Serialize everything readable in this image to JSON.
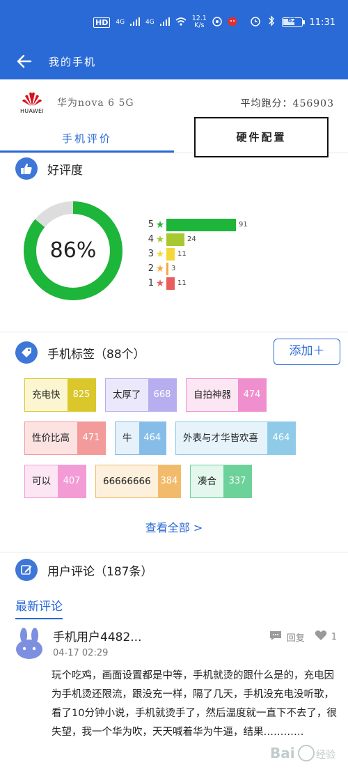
{
  "status": {
    "hd": "HD",
    "signal1": "4G",
    "signal2": "4G",
    "speed": "12.1",
    "speed_unit": "K/s",
    "battery": "62",
    "time": "11:31"
  },
  "app_bar": {
    "title": "我的手机"
  },
  "phone": {
    "brand": "HUAWEI",
    "model": "华为nova 6 5G",
    "score": "平均跑分：456903"
  },
  "tabs": [
    {
      "label": "手机评价"
    },
    {
      "label": "硬件配置"
    }
  ],
  "rating": {
    "title": "好评度",
    "percent_label": "86%",
    "percent": 86,
    "rows": [
      {
        "stars": "5",
        "count": "91",
        "value": 91,
        "color": "#1db53a"
      },
      {
        "stars": "4",
        "count": "24",
        "value": 24,
        "color": "#a8c832"
      },
      {
        "stars": "3",
        "count": "11",
        "value": 11,
        "color": "#f4d83a"
      },
      {
        "stars": "2",
        "count": "3",
        "value": 3,
        "color": "#f5a83a"
      },
      {
        "stars": "1",
        "count": "11",
        "value": 11,
        "color": "#ea5d5d"
      }
    ],
    "ring_color": "#1db53a",
    "ring_track_color": "#dddddd"
  },
  "tags": {
    "title": "手机标签（88个）",
    "add_label": "添加＋",
    "items": [
      {
        "label": "充电快",
        "count": "825",
        "bg": "#fbf6cf",
        "border": "#d9c72b",
        "count_bg": "#d9c72b"
      },
      {
        "label": "太厚了",
        "count": "668",
        "bg": "#ebe8fb",
        "border": "#b7aef0",
        "count_bg": "#b7aef0"
      },
      {
        "label": "自拍神器",
        "count": "474",
        "bg": "#fde6f3",
        "border": "#f08fcd",
        "count_bg": "#f08fcd"
      },
      {
        "label": "性价比高",
        "count": "471",
        "bg": "#fde2e2",
        "border": "#f39a9a",
        "count_bg": "#f39a9a"
      },
      {
        "label": "牛",
        "count": "464",
        "bg": "#e5f1fb",
        "border": "#86bde8",
        "count_bg": "#86bde8"
      },
      {
        "label": "外表与才华皆欢喜",
        "count": "464",
        "bg": "#e6f3fb",
        "border": "#8fcbe8",
        "count_bg": "#8fcbe8"
      },
      {
        "label": "可以",
        "count": "407",
        "bg": "#fde6f3",
        "border": "#f39bd5",
        "count_bg": "#f39bd5"
      },
      {
        "label": "66666666",
        "count": "384",
        "bg": "#fdf0dc",
        "border": "#f2bb6b",
        "count_bg": "#f2bb6b"
      },
      {
        "label": "凑合",
        "count": "337",
        "bg": "#e3f7ec",
        "border": "#6dd29a",
        "count_bg": "#6dd29a"
      }
    ],
    "see_all": "查看全部 >"
  },
  "reviews": {
    "title": "用户评论（187条）",
    "latest_label": "最新评论",
    "items": [
      {
        "user": "手机用户4482...",
        "date": "04-17 02:29",
        "reply_label": "回复",
        "likes": "1",
        "text": "玩个吃鸡，画面设置都是中等，手机就烫的跟什么是的，充电因为手机烫还限流，跟没充一样，隔了几天，手机没充电没听歌，看了10分钟小说，手机就烫手了，然后温度就一直下不去了，很失望，我一个华为吹，天天喊着华为牛逼，结果…………"
      }
    ]
  },
  "watermark": "Bai 经验"
}
